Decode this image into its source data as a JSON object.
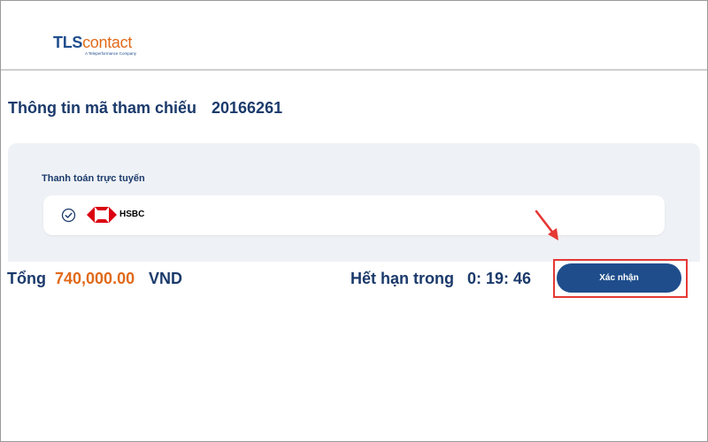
{
  "header": {
    "logo": {
      "brand_first": "TLS",
      "brand_second": "contact",
      "tagline": "A Teleperformance Company"
    }
  },
  "reference": {
    "label": "Thông tin mã tham chiếu",
    "value": "20166261"
  },
  "payment": {
    "section_title": "Thanh toán trực tuyến",
    "selected_option": {
      "bank_name": "HSBC",
      "icon": "hsbc-logo-icon",
      "status_icon": "check-circle-icon"
    }
  },
  "summary": {
    "total_label": "Tổng",
    "total_amount": "740,000.00",
    "currency": "VND",
    "expiry_label": "Hết hạn trong",
    "expiry_time": "0: 19: 46"
  },
  "actions": {
    "confirm_label": "Xác nhận"
  },
  "colors": {
    "primary": "#1f4d8c",
    "accent": "#e06a1b",
    "annotation": "#e53935",
    "panel_bg": "#eef1f5"
  }
}
